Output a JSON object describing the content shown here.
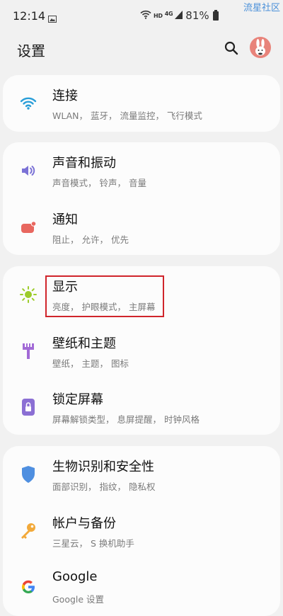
{
  "status_bar": {
    "time": "12:14",
    "network": "HD",
    "signal_tag": "4G",
    "battery": "81%"
  },
  "watermark": "流星社区",
  "header": {
    "title": "设置"
  },
  "colors": {
    "wifi": "#2a9ed8",
    "sound": "#7b72d6",
    "notify": "#e8675f",
    "display": "#9ccc2a",
    "wallpaper": "#a26ad6",
    "lock": "#8b6fd4",
    "shield": "#4f8fe0",
    "key": "#f2a93a",
    "highlight": "#d0252b"
  },
  "items": [
    {
      "title": "连接",
      "subtitle": "WLAN， 蓝牙， 流量监控， 飞行模式",
      "icon": "wifi-icon"
    },
    {
      "title": "声音和振动",
      "subtitle": "声音模式， 铃声， 音量",
      "icon": "speaker-icon"
    },
    {
      "title": "通知",
      "subtitle": "阻止， 允许， 优先",
      "icon": "notification-icon"
    },
    {
      "title": "显示",
      "subtitle": "亮度， 护眼模式， 主屏幕",
      "icon": "brightness-icon"
    },
    {
      "title": "壁纸和主题",
      "subtitle": "壁纸， 主题， 图标",
      "icon": "brush-icon"
    },
    {
      "title": "锁定屏幕",
      "subtitle": "屏幕解锁类型， 息屏提醒， 时钟风格",
      "icon": "lock-icon"
    },
    {
      "title": "生物识别和安全性",
      "subtitle": "面部识别， 指纹， 隐私权",
      "icon": "shield-icon"
    },
    {
      "title": "帐户与备份",
      "subtitle": "三星云， S 换机助手",
      "icon": "key-icon"
    },
    {
      "title": "Google",
      "subtitle": "Google 设置",
      "icon": "google-icon"
    }
  ]
}
